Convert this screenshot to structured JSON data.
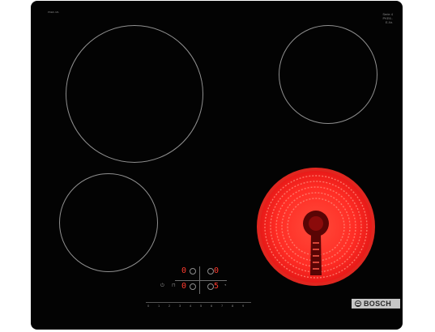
{
  "hob": {
    "brand": "BOSCH",
    "model_code": "PKE6..M1.",
    "spec_text": "Serie 4\nPKE6..\nE-Nr.",
    "zones": [
      {
        "position": "front-left",
        "state": "off"
      },
      {
        "position": "rear-right",
        "state": "off"
      },
      {
        "position": "front-left-bottom",
        "state": "off"
      },
      {
        "position": "front-right",
        "state": "on",
        "glow_color": "#ff1f1f"
      }
    ],
    "controls": {
      "zone_top_left_level": "0",
      "zone_top_right_level": "0",
      "zone_bottom_left_level": "0",
      "zone_bottom_right_level": "5",
      "slider_values": [
        "0",
        "1",
        "2",
        "3",
        "4",
        "5",
        "6",
        "7",
        "8",
        "9"
      ]
    }
  },
  "colors": {
    "glass": "#030303",
    "zone_outline": "#8f8f8f",
    "display_red": "#ff3b2e",
    "active_zone": "#ff1f1f"
  },
  "icons": [
    "power-icon",
    "lock-icon",
    "timer-icon",
    "zone-select-icon",
    "bosch-logo-icon"
  ]
}
